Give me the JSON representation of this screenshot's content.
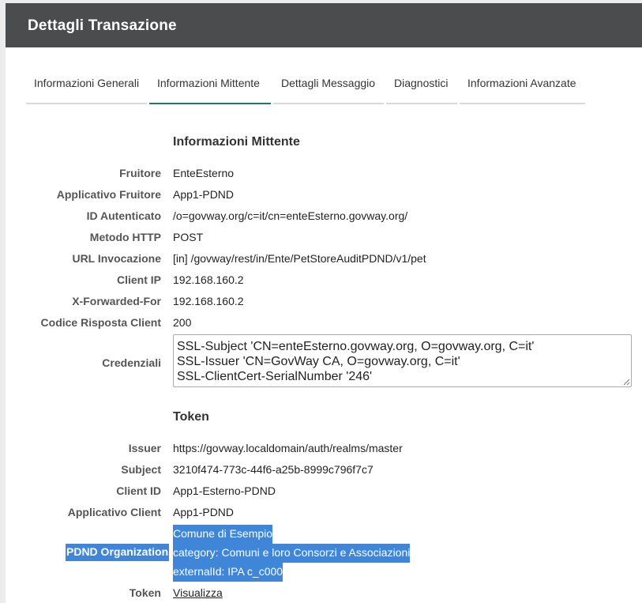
{
  "header": {
    "title": "Dettagli Transazione"
  },
  "tabs": [
    {
      "label": "Informazioni Generali"
    },
    {
      "label": "Informazioni Mittente"
    },
    {
      "label": "Dettagli Messaggio"
    },
    {
      "label": "Diagnostici"
    },
    {
      "label": "Informazioni Avanzate"
    }
  ],
  "mittente": {
    "title": "Informazioni Mittente",
    "rows": [
      {
        "label": "Fruitore",
        "value": "EnteEsterno"
      },
      {
        "label": "Applicativo Fruitore",
        "value": "App1-PDND"
      },
      {
        "label": "ID Autenticato",
        "value": "/o=govway.org/c=it/cn=enteEsterno.govway.org/"
      },
      {
        "label": "Metodo HTTP",
        "value": "POST"
      },
      {
        "label": "URL Invocazione",
        "value": "[in] /govway/rest/in/Ente/PetStoreAuditPDND/v1/pet"
      },
      {
        "label": "Client IP",
        "value": "192.168.160.2"
      },
      {
        "label": "X-Forwarded-For",
        "value": "192.168.160.2"
      },
      {
        "label": "Codice Risposta Client",
        "value": "200"
      }
    ],
    "credenziali": {
      "label": "Credenziali",
      "lines": [
        "SSL-Subject 'CN=enteEsterno.govway.org, O=govway.org, C=it'",
        "SSL-Issuer 'CN=GovWay CA, O=govway.org, C=it'",
        "SSL-ClientCert-SerialNumber '246'"
      ]
    }
  },
  "token": {
    "title": "Token",
    "rows": [
      {
        "label": "Issuer",
        "value": "https://govway.localdomain/auth/realms/master"
      },
      {
        "label": "Subject",
        "value": "3210f474-773c-44f6-a25b-8999c796f7c7"
      },
      {
        "label": "Client ID",
        "value": "App1-Esterno-PDND"
      },
      {
        "label": "Applicativo Client",
        "value": "App1-PDND"
      }
    ],
    "pdnd": {
      "label": "PDND Organization",
      "lines": [
        "Comune di Esempio",
        "category: Comuni e loro Consorzi e Associazioni",
        "externalId: IPA c_c000"
      ]
    },
    "token_row": {
      "label": "Token",
      "link": "Visualizza"
    }
  },
  "colors": {
    "header_bg": "#4b4c4e",
    "active_tab": "#1d7a6a",
    "selection": "#3f86d8"
  }
}
